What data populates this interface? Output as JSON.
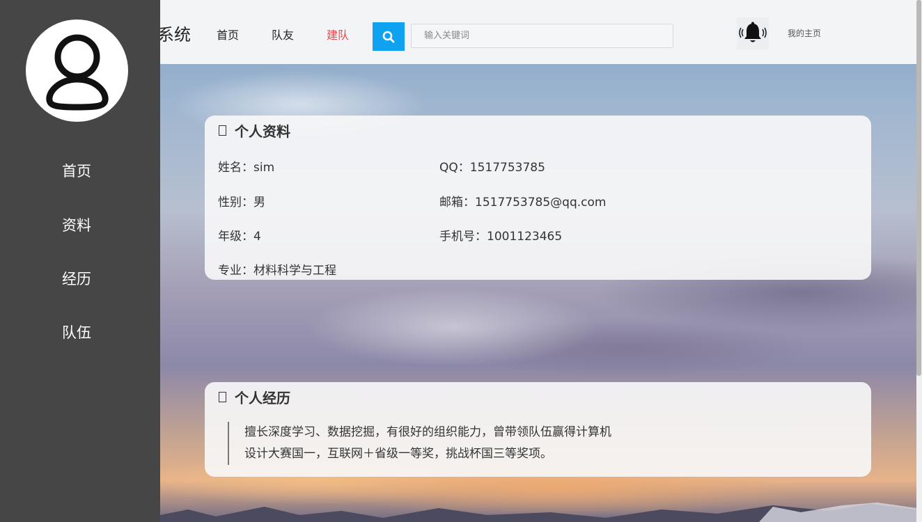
{
  "header": {
    "brand": "系统",
    "nav": [
      "首页",
      "队友",
      "建队"
    ],
    "search_placeholder": "输入关键词",
    "home_link": "我的主页"
  },
  "sidebar": {
    "items": [
      "首页",
      "资料",
      "经历",
      "队伍"
    ]
  },
  "profile": {
    "title": "个人资料",
    "name": "姓名：sim",
    "gender": "性别：男",
    "grade": "年级：4",
    "major": "专业：材料科学与工程",
    "qq": "QQ：1517753785",
    "email": "邮箱：1517753785@qq.com",
    "phone": "手机号：1001123465"
  },
  "experience": {
    "title": "个人经历",
    "line1": "擅长深度学习、数据挖掘，有很好的组织能力，曾带领队伍赢得计算机",
    "line2": "设计大赛国一，互联网＋省级一等奖，挑战杯国三等奖项。"
  },
  "colors": {
    "sidebar_bg": "#464646",
    "active_nav": "#e5484d",
    "search_button": "#0ea2f0"
  }
}
